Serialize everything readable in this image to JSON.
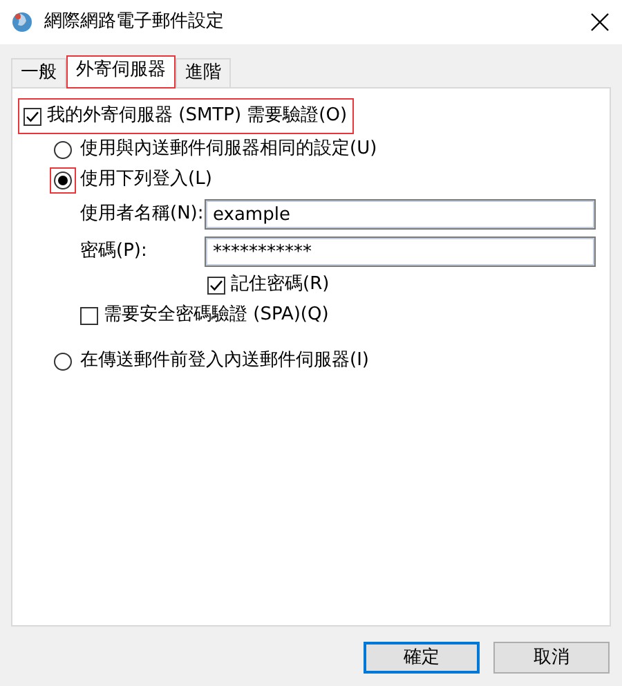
{
  "window": {
    "title": "網際網路電子郵件設定"
  },
  "tabs": [
    {
      "label": "一般",
      "selected": false,
      "highlighted": false
    },
    {
      "label": "外寄伺服器",
      "selected": true,
      "highlighted": true
    },
    {
      "label": "進階",
      "selected": false,
      "highlighted": false
    }
  ],
  "smtp_auth": {
    "label": "我的外寄伺服器 (SMTP) 需要驗證(O)",
    "checked": true,
    "highlighted": true
  },
  "login_options": [
    {
      "label": "使用與內送郵件伺服器相同的設定(U)",
      "selected": false,
      "highlighted": false
    },
    {
      "label": "使用下列登入(L)",
      "selected": true,
      "highlighted": true
    }
  ],
  "fields": [
    {
      "label": "使用者名稱(N):",
      "value": "example"
    },
    {
      "label": "密碼(P):",
      "value": "***********"
    }
  ],
  "remember_password": {
    "label": "記住密碼(R)",
    "checked": true
  },
  "spa": {
    "label": "需要安全密碼驗證 (SPA)(Q)",
    "checked": false
  },
  "login_before": {
    "label": "在傳送郵件前登入內送郵件伺服器(I)",
    "selected": false
  },
  "buttons": [
    {
      "label": "確定",
      "default": true
    },
    {
      "label": "取消",
      "default": false
    }
  ]
}
